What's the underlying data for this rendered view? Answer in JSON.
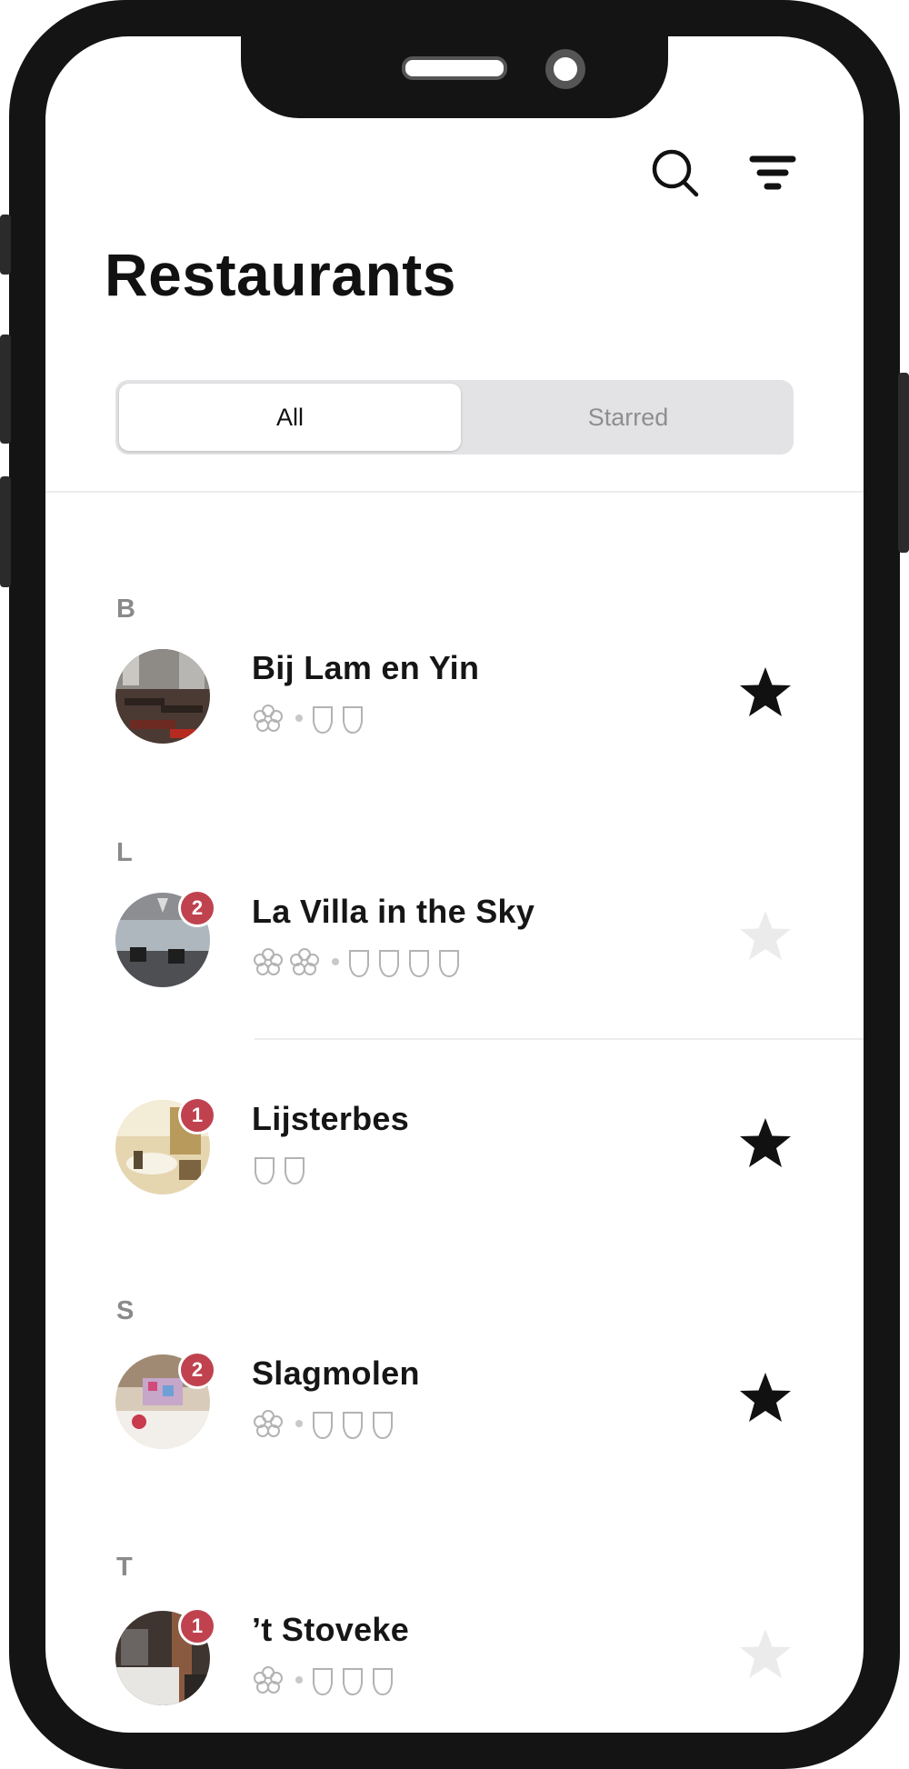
{
  "header": {
    "title": "Restaurants",
    "search_icon": "search-icon",
    "filter_icon": "filter-icon"
  },
  "segments": {
    "all": "All",
    "starred": "Starred",
    "selected": "All"
  },
  "colors": {
    "badge": "#c0424f",
    "star_on": "#111111",
    "star_off": "#ebebeb",
    "accent_text": "#111111",
    "muted_text": "#8a8a8a"
  },
  "sections": [
    {
      "letter": "B",
      "items": [
        {
          "name": "Bij Lam en Yin",
          "badge": "",
          "michelin_stars": 1,
          "toques": 2,
          "starred": true
        }
      ]
    },
    {
      "letter": "L",
      "items": [
        {
          "name": "La Villa in the Sky",
          "badge": "2",
          "michelin_stars": 2,
          "toques": 4,
          "starred": false
        },
        {
          "name": "Lijsterbes",
          "badge": "1",
          "michelin_stars": 0,
          "toques": 2,
          "starred": true
        }
      ]
    },
    {
      "letter": "S",
      "items": [
        {
          "name": "Slagmolen",
          "badge": "2",
          "michelin_stars": 1,
          "toques": 3,
          "starred": true
        }
      ]
    },
    {
      "letter": "T",
      "items": [
        {
          "name": "’t Stoveke",
          "badge": "1",
          "michelin_stars": 1,
          "toques": 3,
          "starred": false
        }
      ]
    }
  ]
}
